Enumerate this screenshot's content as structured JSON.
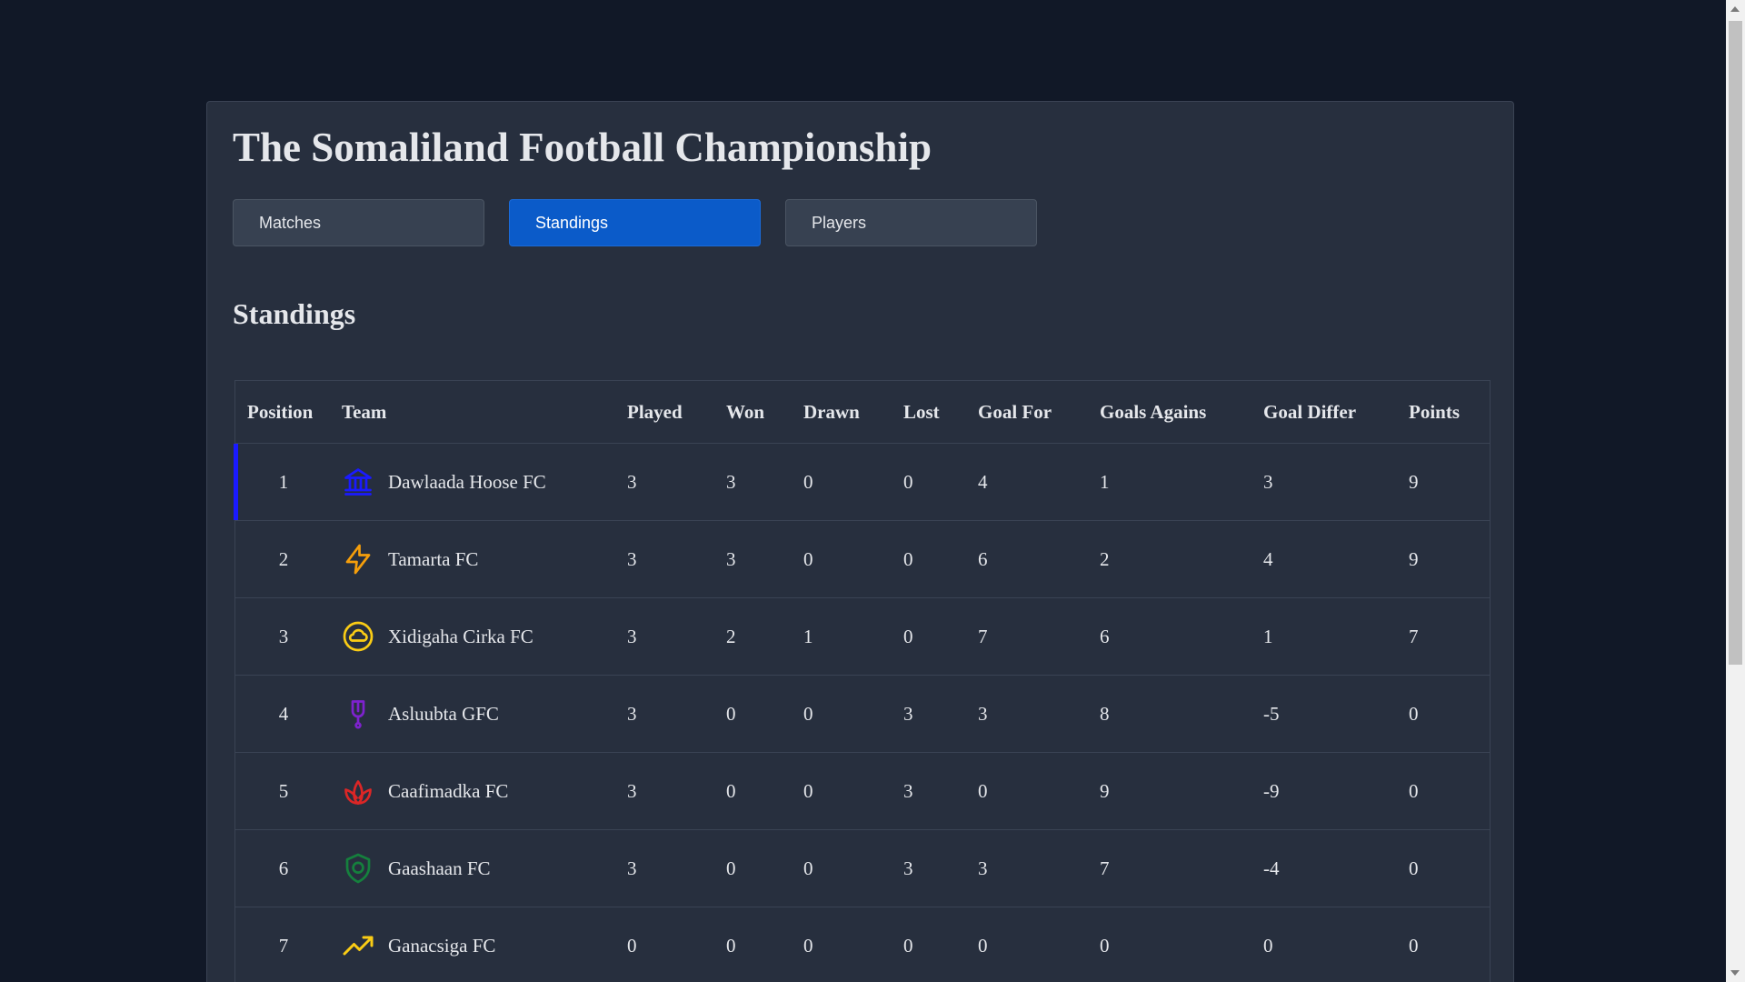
{
  "app": {
    "title": "The Somaliland Football Championship"
  },
  "tabs": [
    {
      "label": "Matches",
      "active": false
    },
    {
      "label": "Standings",
      "active": true
    },
    {
      "label": "Players",
      "active": false
    }
  ],
  "section": {
    "title": "Standings"
  },
  "table": {
    "headers": {
      "position": "Position",
      "team": "Team",
      "played": "Played",
      "won": "Won",
      "drawn": "Drawn",
      "lost": "Lost",
      "goal_for": "Goal For",
      "goals_against": "Goals Agains",
      "goal_diff": "Goal Differ",
      "points": "Points"
    },
    "rows": [
      {
        "position": "1",
        "team": "Dawlaada Hoose FC",
        "icon": "government-building-icon",
        "icon_color": "#1a1aff",
        "played": "3",
        "won": "3",
        "drawn": "0",
        "lost": "0",
        "goal_for": "4",
        "goals_against": "1",
        "goal_diff": "3",
        "points": "9"
      },
      {
        "position": "2",
        "team": "Tamarta FC",
        "icon": "lightning-bolt-icon",
        "icon_color": "#f59e0b",
        "played": "3",
        "won": "3",
        "drawn": "0",
        "lost": "0",
        "goal_for": "6",
        "goals_against": "2",
        "goal_diff": "4",
        "points": "9"
      },
      {
        "position": "3",
        "team": "Xidigaha Cirka FC",
        "icon": "cloud-sun-icon",
        "icon_color": "#facc15",
        "played": "3",
        "won": "2",
        "drawn": "1",
        "lost": "0",
        "goal_for": "7",
        "goals_against": "6",
        "goal_diff": "1",
        "points": "7"
      },
      {
        "position": "4",
        "team": "Asluubta GFC",
        "icon": "medal-icon",
        "icon_color": "#7e22ce",
        "played": "3",
        "won": "0",
        "drawn": "0",
        "lost": "3",
        "goal_for": "3",
        "goals_against": "8",
        "goal_diff": "-5",
        "points": "0"
      },
      {
        "position": "5",
        "team": "Caafimadka FC",
        "icon": "lotus-icon",
        "icon_color": "#dc2626",
        "played": "3",
        "won": "0",
        "drawn": "0",
        "lost": "3",
        "goal_for": "0",
        "goals_against": "9",
        "goal_diff": "-9",
        "points": "0"
      },
      {
        "position": "6",
        "team": "Gaashaan FC",
        "icon": "shield-icon",
        "icon_color": "#15803d",
        "played": "3",
        "won": "0",
        "drawn": "0",
        "lost": "3",
        "goal_for": "3",
        "goals_against": "7",
        "goal_diff": "-4",
        "points": "0"
      },
      {
        "position": "7",
        "team": "Ganacsiga FC",
        "icon": "trending-up-icon",
        "icon_color": "#facc15",
        "played": "0",
        "won": "0",
        "drawn": "0",
        "lost": "0",
        "goal_for": "0",
        "goals_against": "0",
        "goal_diff": "0",
        "points": "0"
      }
    ]
  },
  "colors": {
    "page_bg": "#111827",
    "card_bg": "#272f3e",
    "accent": "#0b5bc9",
    "leader_marker": "#1a1aff"
  }
}
